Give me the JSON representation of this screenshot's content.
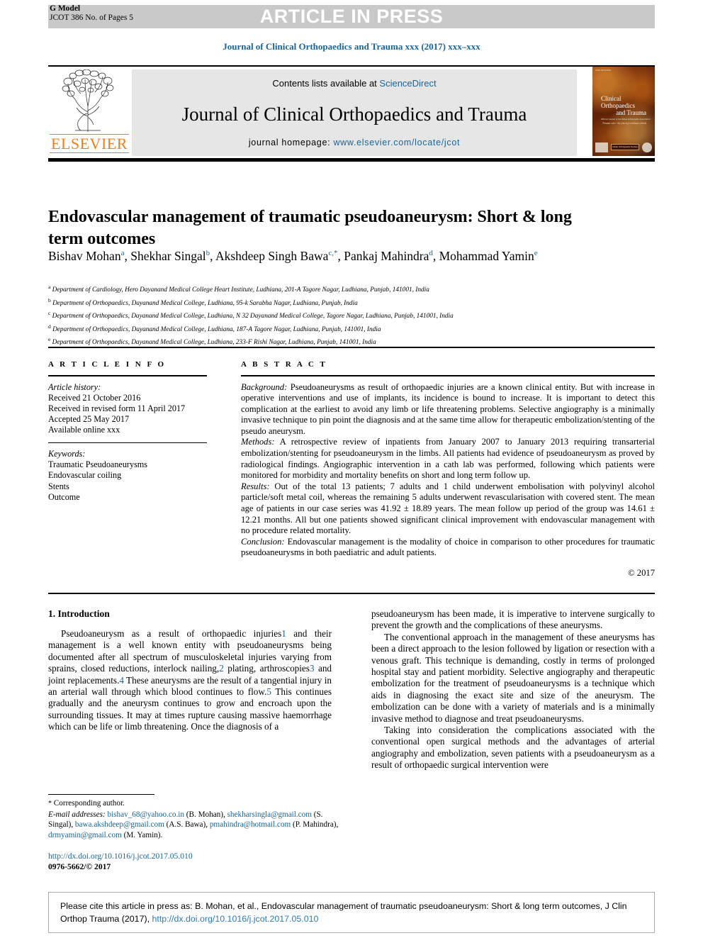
{
  "banner": {
    "press_label": "ARTICLE IN PRESS",
    "gmodel_line1": "G Model",
    "gmodel_line2": "JCOT 386 No. of Pages 5"
  },
  "running_head": "Journal of Clinical Orthopaedics and Trauma xxx (2017) xxx–xxx",
  "masthead": {
    "contents_prefix": "Contents lists available at ",
    "sciencedirect": "ScienceDirect",
    "journal_name": "Journal of Clinical Orthopaedics and Trauma",
    "homepage_label": "journal homepage: ",
    "homepage_url": "www.elsevier.com/locate/jcot",
    "publisher": "ELSEVIER",
    "cover": {
      "pre": "ISSN 0976-5662",
      "title_line1": "Clinical Orthopaedics",
      "title_line2": "and Trauma",
      "subtitle": "Official Journal of the Indian Orthopaedic Association",
      "quote": "Trauma care - the journey continues ahead",
      "badge": "Indian Orthopaedic Society"
    }
  },
  "article": {
    "title": "Endovascular management of traumatic pseudoaneurysm: Short & long term outcomes",
    "authors": [
      {
        "name": "Bishav Mohan",
        "sup": "a",
        "sep": ", "
      },
      {
        "name": "Shekhar Singal",
        "sup": "b",
        "sep": ", "
      },
      {
        "name": "Akshdeep Singh Bawa",
        "sup": "c,*",
        "sep": ", "
      },
      {
        "name": "Pankaj Mahindra",
        "sup": "d",
        "sep": ", "
      },
      {
        "name": "Mohammad Yamin",
        "sup": "e",
        "sep": ""
      }
    ],
    "affiliations": [
      {
        "marker": "a",
        "text": "Department of Cardiology, Hero Dayanand Medical College Heart Institute, Ludhiana, 201-A Tagore Nagar, Ludhiana, Punjab, 141001, India"
      },
      {
        "marker": "b",
        "text": "Department of Orthopaedics, Dayanand Medical College, Ludhiana, 95-k Sarabha Nagar, Ludhiana, Punjab, India"
      },
      {
        "marker": "c",
        "text": "Department of Orthopaedics, Dayanand Medical College, Ludhiana, N 32 Dayanand Medical College, Tagore Nagar, Ludhiana, Punjab, 141001, India"
      },
      {
        "marker": "d",
        "text": "Department of Orthopaedics, Dayanand Medical College, Ludhiana, 187-A Tagore Nagar, Ludhiana, Punjab, 141001, India"
      },
      {
        "marker": "e",
        "text": "Department of Orthopaedics, Dayanand Medical College, Ludhiana, 233-F Rishi Nagar, Ludhiana, Punjab, 141001, India"
      }
    ]
  },
  "article_info": {
    "label": "A R T I C L E   I N F O",
    "history_label": "Article history:",
    "history": [
      "Received 21 October 2016",
      "Received in revised form 11 April 2017",
      "Accepted 25 May 2017",
      "Available online xxx"
    ],
    "keywords_label": "Keywords:",
    "keywords": [
      "Traumatic Pseudoaneurysms",
      "Endovascular coiling",
      "Stents",
      "Outcome"
    ]
  },
  "abstract": {
    "label": "A B S T R A C T",
    "sections": [
      {
        "lead": "Background:",
        "text": " Pseudoaneurysms as result of orthopaedic injuries are a known clinical entity. But with increase in operative interventions and use of implants, its incidence is bound to increase. It is important to detect this complication at the earliest to avoid any limb or life threatening problems. Selective angiography is a minimally invasive technique to pin point the diagnosis and at the same time allow for therapeutic embolization/stenting of the pseudo aneurysm."
      },
      {
        "lead": "Methods:",
        "text": " A retrospective review of inpatients from January 2007 to January 2013 requiring transarterial embolization/stenting for pseudoaneurysm in the limbs. All patients had evidence of pseudoaneurysm as proved by radiological findings. Angiographic intervention in a cath lab was performed, following which patients were monitored for morbidity and mortality benefits on short and long term follow up."
      },
      {
        "lead": "Results:",
        "text": " Out of the total 13 patients; 7 adults and 1 child underwent embolisation with polyvinyl alcohol particle/soft metal coil, whereas the remaining 5 adults underwent revascularisation with covered stent. The mean age of patients in our case series was 41.92 ± 18.89 years. The mean follow up period of the group was 14.61 ± 12.21 months. All but one patients showed significant clinical improvement with endovascular management with no procedure related mortality."
      },
      {
        "lead": "Conclusion:",
        "text": " Endovascular management is the modality of choice in comparison to other procedures for traumatic pseudoaneurysms in both paediatric and adult patients."
      }
    ],
    "copyright": "© 2017"
  },
  "introduction": {
    "heading": "1. Introduction",
    "left_paragraphs": [
      "Pseudoaneurysm as a result of orthopaedic injuries1 and their management is a well known entity with pseudoaneurysms being documented after all spectrum of musculoskeletal injuries varying from sprains, closed reductions, interlock nailing,2 plating, arthroscopies3 and joint replacements.4 These aneurysms are the result of a tangential injury in an arterial wall through which blood continues to flow.5 This continues gradually and the aneurysm continues to grow and encroach upon the surrounding tissues. It may at times rupture causing massive haemorrhage which can be life or limb threatening. Once the diagnosis of a"
    ],
    "right_paragraphs": [
      "pseudoaneurysm has been made, it is imperative to intervene surgically to prevent the growth and the complications of these aneurysms.",
      "The conventional approach in the management of these aneurysms has been a direct approach to the lesion followed by ligation or resection with a venous graft. This technique is demanding, costly in terms of prolonged hospital stay and patient morbidity. Selective angiography and therapeutic embolization for the treatment of pseudoaneurysms is a technique which aids in diagnosing the exact site and size of the aneurysm. The embolization can be done with a variety of materials and is a minimally invasive method to diagnose and treat pseudoaneurysms.",
      "Taking into consideration the complications associated with the conventional open surgical methods and the advantages of arterial angiography and embolization, seven patients with a pseudoaneurysm as a result of orthopaedic surgical intervention were"
    ]
  },
  "footnotes": {
    "corresponding": "Corresponding author.",
    "email_label": "E-mail addresses:",
    "emails": [
      {
        "address": "bishav_68@yahoo.co.in",
        "owner": " (B. Mohan),"
      },
      {
        "address": "shekharsingla@gmail.com",
        "owner": " (S. Singal),"
      },
      {
        "address": "bawa.akshdeep@gmail.com",
        "owner": " (A.S. Bawa),"
      },
      {
        "address": "pmahindra@hotmail.com",
        "owner": " (P. Mahindra),"
      },
      {
        "address": "drmyamin@gmail.com",
        "owner": " (M. Yamin)."
      }
    ],
    "doi": "http://dx.doi.org/10.1016/j.jcot.2017.05.010",
    "issn": "0976-5662/© 2017"
  },
  "citation_box": {
    "text": "Please cite this article in press as: B. Mohan, et al., Endovascular management of traumatic pseudoaneurysm: Short & long term outcomes, J Clin Orthop Trauma (2017), ",
    "doi": "http://dx.doi.org/10.1016/j.jcot.2017.05.010"
  }
}
